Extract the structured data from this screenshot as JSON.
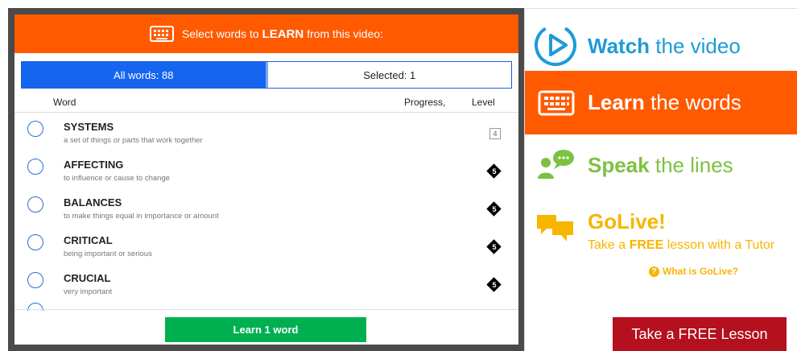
{
  "panel": {
    "header": {
      "prefix": "Select words to",
      "emph": "LEARN",
      "suffix": "from this video:"
    },
    "tabs": {
      "all_label": "All words: 88",
      "selected_label": "Selected: 1"
    },
    "columns": {
      "word": "Word",
      "progress": "Progress,",
      "level": "Level"
    },
    "words": [
      {
        "word": "SYSTEMS",
        "definition": "a set of things or parts that work together",
        "level": "4",
        "level_style": "box"
      },
      {
        "word": "AFFECTING",
        "definition": "to influence or cause to change",
        "level": "5",
        "level_style": "diamond"
      },
      {
        "word": "BALANCES",
        "definition": "to make things equal in importance or amount",
        "level": "5",
        "level_style": "diamond"
      },
      {
        "word": "CRITICAL",
        "definition": "being important or serious",
        "level": "5",
        "level_style": "diamond"
      },
      {
        "word": "CRUCIAL",
        "definition": "very important",
        "level": "5",
        "level_style": "diamond"
      }
    ],
    "learn_button": "Learn 1 word"
  },
  "sidebar": {
    "watch": {
      "strong": "Watch",
      "rest": "the video"
    },
    "learn": {
      "strong": "Learn",
      "rest": "the words"
    },
    "speak": {
      "strong": "Speak",
      "rest": "the lines"
    },
    "golive": {
      "title": "GoLive!",
      "sub_pre": "Take a",
      "sub_strong": "FREE",
      "sub_post": "lesson with a Tutor",
      "what": "What is GoLive?"
    },
    "free_button": "Take a FREE Lesson"
  },
  "colors": {
    "orange": "#ff5a00",
    "blue": "#1565f0",
    "watch_blue": "#1e9bd7",
    "green": "#7dc142",
    "button_green": "#00b050",
    "golive_yellow": "#f7b500",
    "red": "#b4101e"
  },
  "icons": {
    "header": "keyboard-icon",
    "watch": "play-circle-icon",
    "learn": "keyboard-icon",
    "speak": "speaking-person-icon",
    "golive": "chat-bubbles-icon",
    "help": "question-circle-icon"
  }
}
